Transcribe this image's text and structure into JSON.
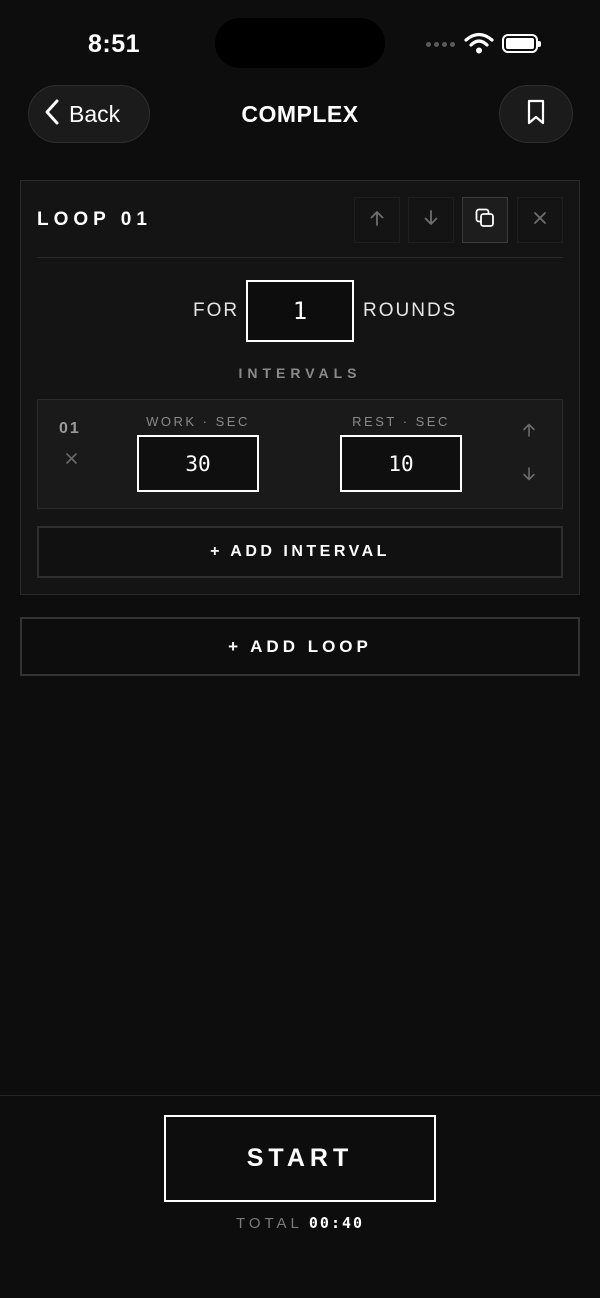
{
  "status_bar": {
    "time": "8:51"
  },
  "nav": {
    "back_label": "Back",
    "title": "COMPLEX"
  },
  "loop": {
    "title": "LOOP 01",
    "for_label": "FOR",
    "rounds_value": "1",
    "rounds_label": "ROUNDS",
    "intervals_heading": "INTERVALS",
    "intervals": [
      {
        "index": "01",
        "work_label": "WORK · SEC",
        "work_value": "30",
        "rest_label": "REST · SEC",
        "rest_value": "10"
      }
    ],
    "add_interval_label": "+ ADD INTERVAL"
  },
  "add_loop_label": "+ ADD LOOP",
  "footer": {
    "start_label": "START",
    "total_label": "TOTAL",
    "total_value": "00:40"
  }
}
